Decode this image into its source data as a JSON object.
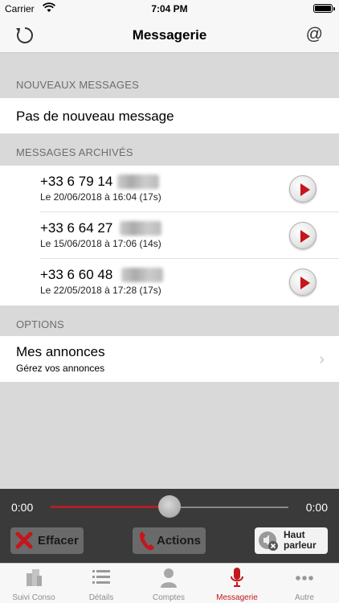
{
  "status_bar": {
    "carrier": "Carrier",
    "time": "7:04 PM"
  },
  "nav": {
    "title": "Messagerie",
    "refresh_icon": "refresh-icon",
    "at_symbol": "@"
  },
  "sections": {
    "new_header": "NOUVEAUX MESSAGES",
    "new_empty": "Pas de nouveau message",
    "archived_header": "MESSAGES ARCHIVÉS",
    "options_header": "OPTIONS"
  },
  "archived": [
    {
      "number": "+33 6 79 14",
      "date": "Le 20/06/2018 à 16:04 (17s)"
    },
    {
      "number": "+33 6 64 27",
      "date": "Le 15/06/2018 à 17:06 (14s)"
    },
    {
      "number": "+33 6 60 48",
      "date": "Le 22/05/2018 à 17:28 (17s)"
    }
  ],
  "options": {
    "title": "Mes annonces",
    "subtitle": "Gérez vos annonces",
    "chevron": "›"
  },
  "player": {
    "time_current": "0:00",
    "time_total": "0:00",
    "progress": 0.5,
    "erase_label": "Effacer",
    "actions_label": "Actions",
    "speaker_line1": "Haut",
    "speaker_line2": "parleur"
  },
  "tabs": [
    {
      "label": "Suivi Conso",
      "icon": "buildings-icon"
    },
    {
      "label": "Détails",
      "icon": "list-icon"
    },
    {
      "label": "Comptes",
      "icon": "person-icon"
    },
    {
      "label": "Messagerie",
      "icon": "microphone-icon",
      "active": true
    },
    {
      "label": "Autre",
      "icon": "more-icon"
    }
  ],
  "colors": {
    "accent": "#c4161c",
    "player_bg": "#3a3a3a",
    "section_bg": "#d9d9d9"
  }
}
